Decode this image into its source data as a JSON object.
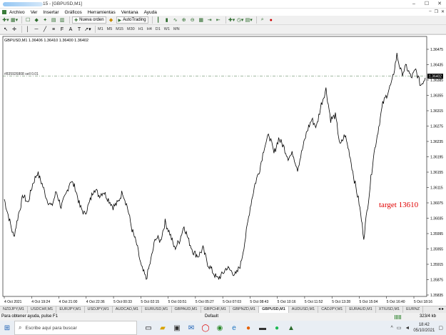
{
  "window": {
    "title": "15 - [GBPUSD,M1]"
  },
  "menu": [
    "Archivo",
    "Ver",
    "Insertar",
    "Gráficos",
    "Herramientas",
    "Ventana",
    "Ayuda"
  ],
  "toolbar": {
    "new_order": "Nueva orden",
    "autotrading": "AutoTrading",
    "timeframes": [
      "M1",
      "M5",
      "M15",
      "M30",
      "H1",
      "H4",
      "D1",
      "W1",
      "MN"
    ]
  },
  "chart": {
    "info": "GBPUSD,M1  1.36406 1.36410 1.36400 1.36402",
    "order_line_label": "#835926808 sell 0.01",
    "annotation": "target 13610",
    "current_price": "1.36402",
    "accent_annotation": "#e00000",
    "order_line_color": "#6a8f6a"
  },
  "chart_data": {
    "type": "line",
    "y_ticks": [
      "1.36475",
      "1.36435",
      "1.36385",
      "1.36355",
      "1.36315",
      "1.36275",
      "1.36235",
      "1.36195",
      "1.36155",
      "1.36115",
      "1.36075",
      "1.36035",
      "1.35995",
      "1.35955",
      "1.35915",
      "1.35875",
      "1.35835"
    ],
    "ylim": [
      1.35835,
      1.3649
    ],
    "x_ticks": [
      "4 Oct 2021",
      "4 Oct 19:24",
      "4 Oct 21:00",
      "4 Oct 22:36",
      "5 Oct 00:33",
      "5 Oct 02:15",
      "5 Oct 03:51",
      "5 Oct 05:27",
      "5 Oct 07:03",
      "5 Oct 08:43",
      "5 Oct 10:16",
      "5 Oct 11:52",
      "5 Oct 13:28",
      "5 Oct 15:04",
      "5 Oct 16:40",
      "5 Oct 18:16"
    ],
    "order_level": 1.36404,
    "series": [
      {
        "values": [
          1.3608,
          1.3603,
          1.3598,
          1.3604,
          1.3609,
          1.3607,
          1.3612,
          1.3615,
          1.3612,
          1.3608,
          1.3606,
          1.361,
          1.3606,
          1.3609,
          1.3613,
          1.3611,
          1.3606,
          1.3604,
          1.3607,
          1.3611,
          1.3609,
          1.361,
          1.3608,
          1.3606,
          1.3607,
          1.361,
          1.3606,
          1.36,
          1.3596,
          1.359,
          1.3587,
          1.3592,
          1.3598,
          1.3597,
          1.3602,
          1.3599,
          1.3595,
          1.3597,
          1.3601,
          1.3597,
          1.3594,
          1.3593,
          1.3595,
          1.3591,
          1.3589,
          1.3587,
          1.3588,
          1.359,
          1.3589,
          1.3588,
          1.3591,
          1.3598,
          1.3606,
          1.3612,
          1.3616,
          1.3622,
          1.3625,
          1.362,
          1.3624,
          1.3622,
          1.3619,
          1.362,
          1.3616,
          1.3621,
          1.3626,
          1.3629,
          1.3627,
          1.3633,
          1.3637,
          1.3629,
          1.363,
          1.3622,
          1.3625,
          1.362,
          1.3613,
          1.3607,
          1.3598,
          1.3608,
          1.3619,
          1.3626,
          1.3633,
          1.3636,
          1.3639,
          1.3646,
          1.3641,
          1.3643,
          1.364,
          1.3642,
          1.3638,
          1.364
        ]
      }
    ]
  },
  "tabs": [
    "NZDJPY,M1",
    "USDCHF,M1",
    "EURJPY,M1",
    "USDJPY,M1",
    "AUDCAD,M1",
    "EURUSD,M1",
    "GBPAUD,M1",
    "GBPCHF,M1",
    "GBPNZD,M1",
    "GBPUSD,M1",
    "AUDUSD,M1",
    "CADJPY,M1",
    "EURAUD,M1",
    "XTIUSD,M1",
    "EURNZ"
  ],
  "active_tab": 9,
  "status": {
    "help": "Para obtener ayuda, pulse F1",
    "profile": "Default",
    "traffic": "323/4 kb"
  },
  "taskbar": {
    "search_placeholder": "Escribe aquí para buscar",
    "time": "18:42",
    "date": "05/10/2021"
  }
}
